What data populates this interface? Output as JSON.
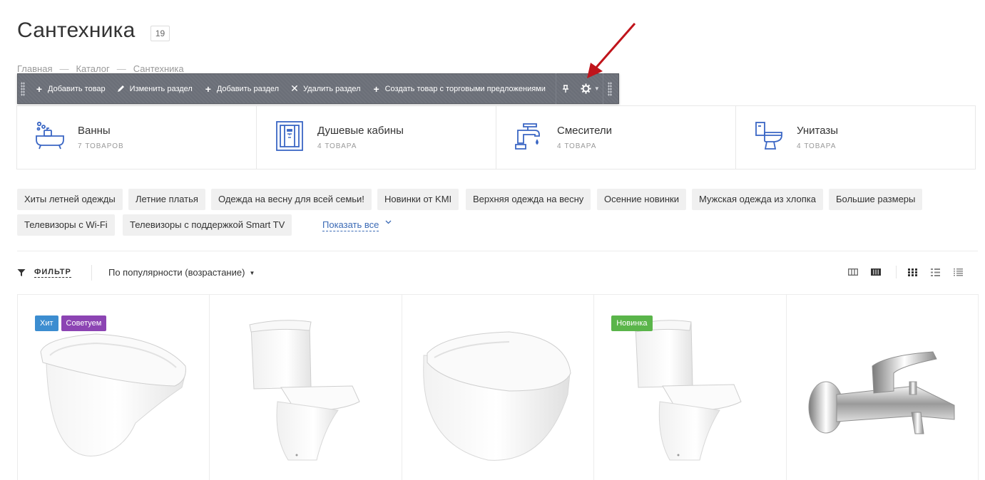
{
  "page": {
    "title": "Сантехника",
    "count": "19"
  },
  "breadcrumb": [
    "Главная",
    "—",
    "Каталог",
    "—",
    "Сантехника"
  ],
  "admin_panel": {
    "buttons": [
      {
        "icon": "plus-icon",
        "label": "Добавить товар"
      },
      {
        "icon": "pencil-icon",
        "label": "Изменить раздел"
      },
      {
        "icon": "plus-icon",
        "label": "Добавить раздел"
      },
      {
        "icon": "close-icon",
        "label": "Удалить раздел"
      },
      {
        "icon": "plus-icon",
        "label": "Создать товар с торговыми предложениями"
      }
    ],
    "pin_icon": "pin-icon",
    "settings_icon": "gear-icon"
  },
  "categories": [
    {
      "name": "Ванны",
      "count": "7 товаров",
      "icon": "bathtub-icon"
    },
    {
      "name": "Душевые кабины",
      "count": "4 товара",
      "icon": "shower-cabin-icon"
    },
    {
      "name": "Смесители",
      "count": "4 товара",
      "icon": "faucet-icon"
    },
    {
      "name": "Унитазы",
      "count": "4 товара",
      "icon": "toilet-icon"
    }
  ],
  "tags": [
    "Хиты летней одежды",
    "Летние платья",
    "Одежда на весну для всей семьи!",
    "Новинки от KMI",
    "Верхняя одежда на весну",
    "Осенние новинки",
    "Мужская одежда из хлопка",
    "Большие размеры",
    "Телевизоры с Wi-Fi",
    "Телевизоры с поддержкой Smart TV"
  ],
  "show_all": "Показать все",
  "filter": {
    "label": "ФИЛЬТР",
    "sort": "По популярности (возрастание)"
  },
  "colors": {
    "accent": "#3b6ab5",
    "icon_blue": "#3a66c4",
    "badge_hit": "#3c8dd0",
    "badge_recommend": "#8c44b3",
    "badge_new": "#5ab54a",
    "admin_bar": "#6b6f78"
  },
  "products": [
    {
      "badges": [
        {
          "label": "Хит",
          "color": "#3c8dd0"
        },
        {
          "label": "Советуем",
          "color": "#8c44b3"
        }
      ]
    },
    {
      "badges": []
    },
    {
      "badges": []
    },
    {
      "badges": [
        {
          "label": "Новинка",
          "color": "#5ab54a"
        }
      ]
    },
    {
      "badges": []
    }
  ]
}
